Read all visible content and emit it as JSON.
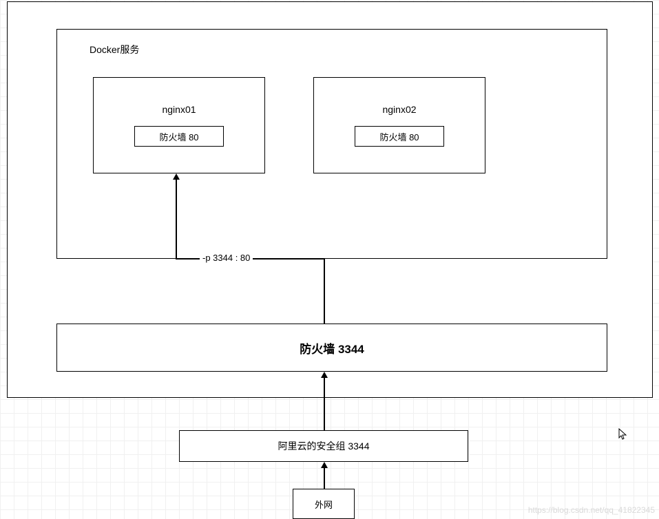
{
  "docker": {
    "label": "Docker服务",
    "containers": [
      {
        "name": "nginx01",
        "firewall": "防火墙  80"
      },
      {
        "name": "nginx02",
        "firewall": "防火墙  80"
      }
    ],
    "port_mapping": "-p 3344 : 80"
  },
  "host_firewall": "防火墙   3344",
  "aliyun_sg": "阿里云的安全组   3344",
  "external": "外网",
  "watermark": "https://blog.csdn.net/qq_41822345"
}
